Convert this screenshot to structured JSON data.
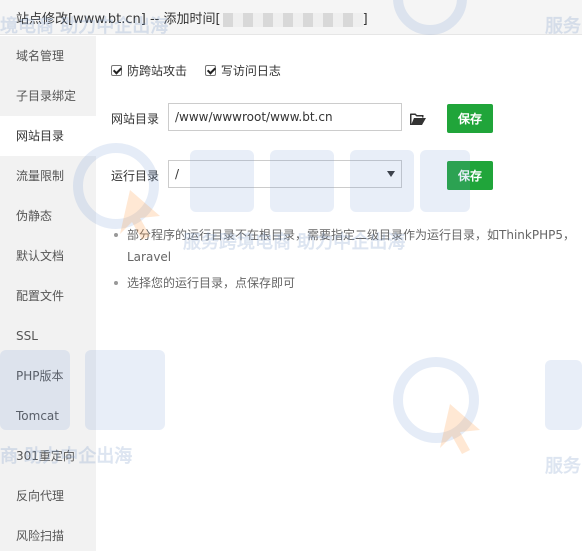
{
  "window": {
    "title": "站点修改[www.bt.cn] -- 添加时间[",
    "title_end": "]"
  },
  "sidebar": {
    "items": [
      {
        "label": "域名管理"
      },
      {
        "label": "子目录绑定"
      },
      {
        "label": "网站目录"
      },
      {
        "label": "流量限制"
      },
      {
        "label": "伪静态"
      },
      {
        "label": "默认文档"
      },
      {
        "label": "配置文件"
      },
      {
        "label": "SSL"
      },
      {
        "label": "PHP版本"
      },
      {
        "label": "Tomcat"
      },
      {
        "label": "301重定向"
      },
      {
        "label": "反向代理"
      },
      {
        "label": "风险扫描"
      }
    ],
    "active_index": 2
  },
  "options": {
    "cross_site": {
      "label": "防跨站攻击",
      "checked": true
    },
    "access_log": {
      "label": "写访问日志",
      "checked": true
    }
  },
  "site_dir": {
    "label": "网站目录",
    "value": "/www/wwwroot/www.bt.cn",
    "save_label": "保存"
  },
  "run_dir": {
    "label": "运行目录",
    "value": "/",
    "save_label": "保存"
  },
  "tips": [
    "部分程序的运行目录不在根目录，需要指定二级目录作为运行目录，如ThinkPHP5，Laravel",
    "选择您的运行目录，点保存即可"
  ],
  "watermark": {
    "text": "服务跨境电商 助力中企出海",
    "brand": "主机侦探",
    "fragment_1": "服务",
    "fragment_2": "境电商 助力中企出海",
    "fragment_3": "商 助力中企出海",
    "brand_fragment": "侦探"
  },
  "colors": {
    "primary": "#20a53a",
    "sidebar_bg": "#f2f2f2",
    "titlebar_bg": "#f5f5f5"
  }
}
